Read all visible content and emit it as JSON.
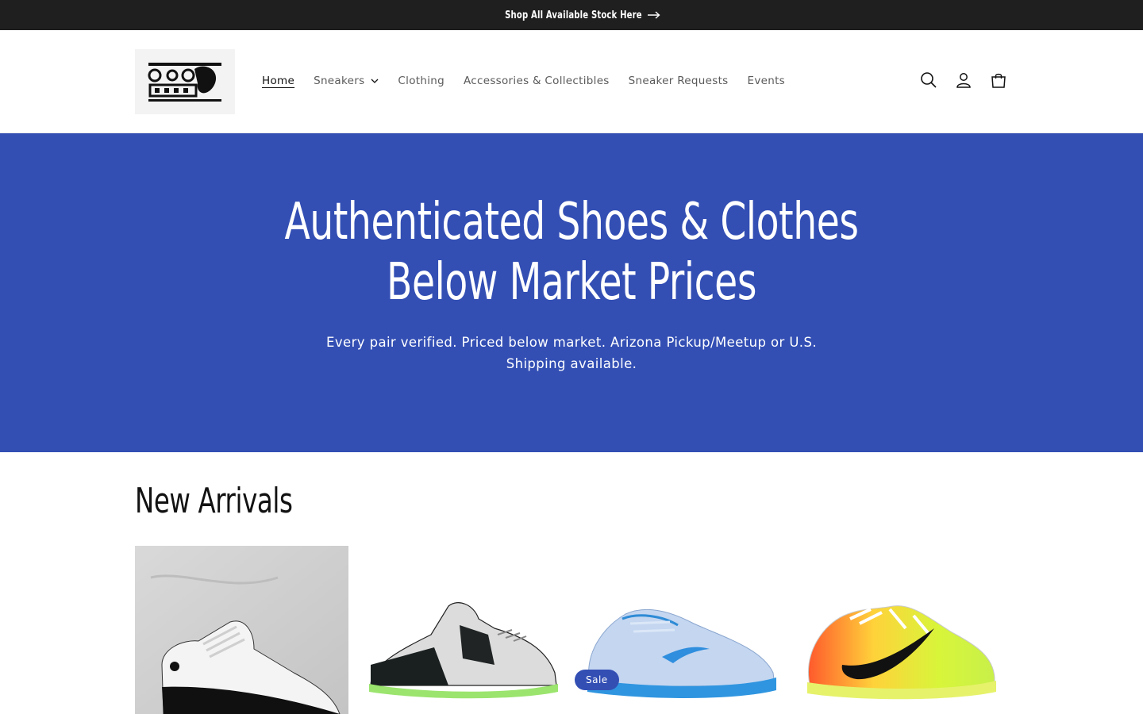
{
  "announcement": {
    "text": "Shop All Available Stock Here"
  },
  "header": {
    "logo_alt": "G.O.G Kicks",
    "nav": [
      {
        "label": "Home",
        "active": true
      },
      {
        "label": "Sneakers",
        "has_dropdown": true
      },
      {
        "label": "Clothing"
      },
      {
        "label": "Accessories & Collectibles"
      },
      {
        "label": "Sneaker Requests"
      },
      {
        "label": "Events"
      }
    ],
    "icons": [
      "search-icon",
      "account-icon",
      "cart-icon"
    ]
  },
  "hero": {
    "title_line1": "Authenticated Shoes & Clothes",
    "title_line2": "Below Market Prices",
    "subtitle": "Every pair verified. Priced below market. Arizona Pickup/Meetup or U.S. Shipping available."
  },
  "new_arrivals": {
    "title": "New Arrivals",
    "products": [
      {
        "image": "sneaker-concord-high",
        "badge": ""
      },
      {
        "image": "sneaker-grey-green-strap",
        "badge": ""
      },
      {
        "image": "sneaker-light-blue-low",
        "badge": "Sale"
      },
      {
        "image": "sneaker-rainbow-volt",
        "badge": ""
      }
    ]
  },
  "colors": {
    "announcement_bg": "#1f1f1f",
    "hero_bg": "#334fb4",
    "badge_bg": "#334fb4",
    "text": "#121212"
  }
}
